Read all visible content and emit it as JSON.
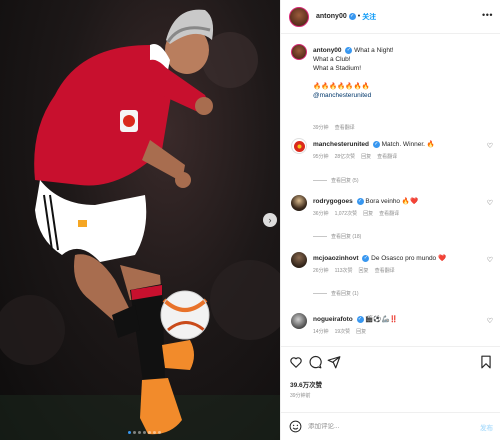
{
  "header": {
    "username": "antony00",
    "separator": "•",
    "follow_label": "关注",
    "more_icon": "more-horizontal-icon"
  },
  "post": {
    "username": "antony00",
    "caption_lines": [
      "What a Night!",
      "What a Club!",
      "What a Stadium!"
    ],
    "fire_emojis": "🔥🔥🔥🔥🔥🔥🔥",
    "mention": "@manchesterunited",
    "time": "39分钟",
    "translate": "查看翻译"
  },
  "comments": [
    {
      "username": "manchesterunited",
      "text": "Match. Winner. 🔥",
      "time": "95分钟",
      "likes": "28亿次赞",
      "reply": "回复",
      "translate": "查看翻译",
      "replies": "查看回复 (5)"
    },
    {
      "username": "rodrygogoes",
      "text": "Bora veinho 🔥❤️",
      "time": "36分钟",
      "likes": "1,072次赞",
      "reply": "回复",
      "translate": "查看翻译",
      "replies": "查看回复 (18)"
    },
    {
      "username": "mcjoaozinhovt",
      "text": "De Osasco pro mundo ❤️",
      "time": "26分钟",
      "likes": "113次赞",
      "reply": "回复",
      "translate": "查看翻译",
      "replies": "查看回复 (1)"
    },
    {
      "username": "nogueirafoto",
      "text": "🎬⚽🦾‼️",
      "time": "14分钟",
      "likes": "19次赞",
      "reply": "回复",
      "translate": "",
      "replies": ""
    }
  ],
  "actions": {
    "like_icon": "heart-icon",
    "comment_icon": "comment-icon",
    "share_icon": "paper-plane-icon",
    "save_icon": "bookmark-icon",
    "likes_count": "39.6万次赞",
    "posted_time": "39分钟前"
  },
  "composer": {
    "emoji_icon": "smiley-icon",
    "placeholder": "添加评论...",
    "post_label": "发布"
  },
  "media": {
    "next_icon": "chevron-right-icon",
    "dots": 7,
    "active_dot": 0
  },
  "colors": {
    "accent": "#0095f6",
    "verified": "#3897f0",
    "jersey_red": "#c8102e",
    "muted": "#8e8e8e",
    "like_red": "#ed4956"
  }
}
